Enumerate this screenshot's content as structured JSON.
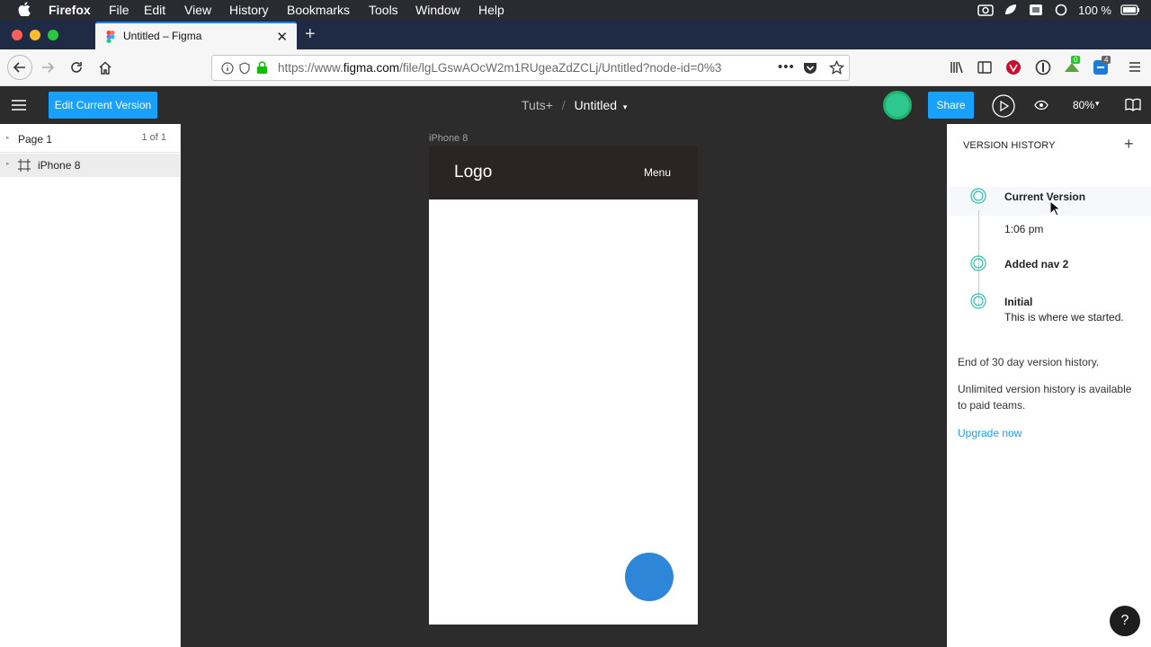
{
  "mac_menubar": {
    "app": "Firefox",
    "items": [
      "File",
      "Edit",
      "View",
      "History",
      "Bookmarks",
      "Tools",
      "Window",
      "Help"
    ],
    "battery": "100 %"
  },
  "browser": {
    "tab_title": "Untitled – Figma",
    "url_prefix": "https://www.",
    "url_domain": "figma.com",
    "url_path": "/file/lgLGswAOcW2m1RUgeaZdZCLj/Untitled?node-id=0%3",
    "badge_count_1": "0",
    "badge_count_2": "4"
  },
  "figma_toolbar": {
    "edit_button": "Edit Current Version",
    "team": "Tuts+",
    "separator": "/",
    "file": "Untitled",
    "share_button": "Share",
    "zoom": "80%"
  },
  "left_panel": {
    "page_name": "Page 1",
    "page_count": "1 of 1",
    "layer_name": "iPhone 8"
  },
  "canvas": {
    "frame_label": "iPhone 8",
    "logo_text": "Logo",
    "menu_text": "Menu",
    "header_color": "#2b2424",
    "fab_color": "#2d86d8"
  },
  "version_history": {
    "title": "VERSION HISTORY",
    "versions": [
      {
        "title": "Current Version",
        "subtitle": "1:06 pm"
      },
      {
        "title": "Added nav 2",
        "subtitle": ""
      },
      {
        "title": "Initial",
        "subtitle": "This is where we started."
      }
    ],
    "end_note": "End of 30 day version history.",
    "unlimited_note": "Unlimited version history is available to paid teams.",
    "upgrade_link": "Upgrade now",
    "accent": "#2bc4b0"
  },
  "help": "?"
}
